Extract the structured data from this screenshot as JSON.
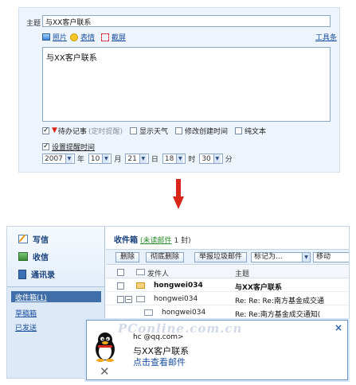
{
  "compose": {
    "subject_label": "主题",
    "subject_value": "与XX客户联系",
    "tools": {
      "photo": "照片",
      "emoji": "表情",
      "screenshot": "截屏",
      "toolbox": "工具条"
    },
    "body_text": "与XX客户联系",
    "options": {
      "todo": "待办记事",
      "todo_hint": "(定时提醒)",
      "weather": "显示天气",
      "edit_time": "修改创建时间",
      "plain_text": "纯文本"
    },
    "remind_label": "设置提醒时间",
    "datetime": {
      "year": "2007",
      "year_unit": "年",
      "month": "10",
      "month_unit": "月",
      "day": "21",
      "day_unit": "日",
      "hour": "18",
      "hour_unit": "时",
      "minute": "30",
      "minute_unit": "分"
    }
  },
  "sidebar": {
    "write": "写信",
    "receive": "收信",
    "contacts": "通讯录",
    "inbox": "收件箱(1)",
    "drafts": "草稿箱",
    "sent": "已发送"
  },
  "inbox": {
    "title": "收件箱",
    "unread_link": "(未读邮件",
    "count": "1 封)",
    "toolbar": {
      "delete": "删除",
      "purge": "彻底删除",
      "spam": "举报垃圾邮件",
      "mark_as": "标记为...",
      "move": "移动"
    },
    "columns": {
      "sender": "发件人",
      "subject": "主题"
    },
    "rows": [
      {
        "sender": "hongwei034",
        "subject": "与XX客户联系",
        "unread": true
      },
      {
        "sender": "hongwei034",
        "subject": "Re: Re: Re:南方基金成交通",
        "unread": false
      },
      {
        "sender": "hongwei034",
        "subject": "Re: Re:南方基金成交通知(",
        "unread": false
      }
    ]
  },
  "popup": {
    "from": "hc  @qq.com>",
    "subject": "与XX客户联系",
    "link": "点击查看邮件",
    "close": "×",
    "dismiss": "✕"
  },
  "watermark": "PConline.com.cn",
  "colors": {
    "accent": "#163f7a",
    "link": "#1a4fa0",
    "arrow": "#d8261b",
    "unread": "#2a8a2a"
  }
}
